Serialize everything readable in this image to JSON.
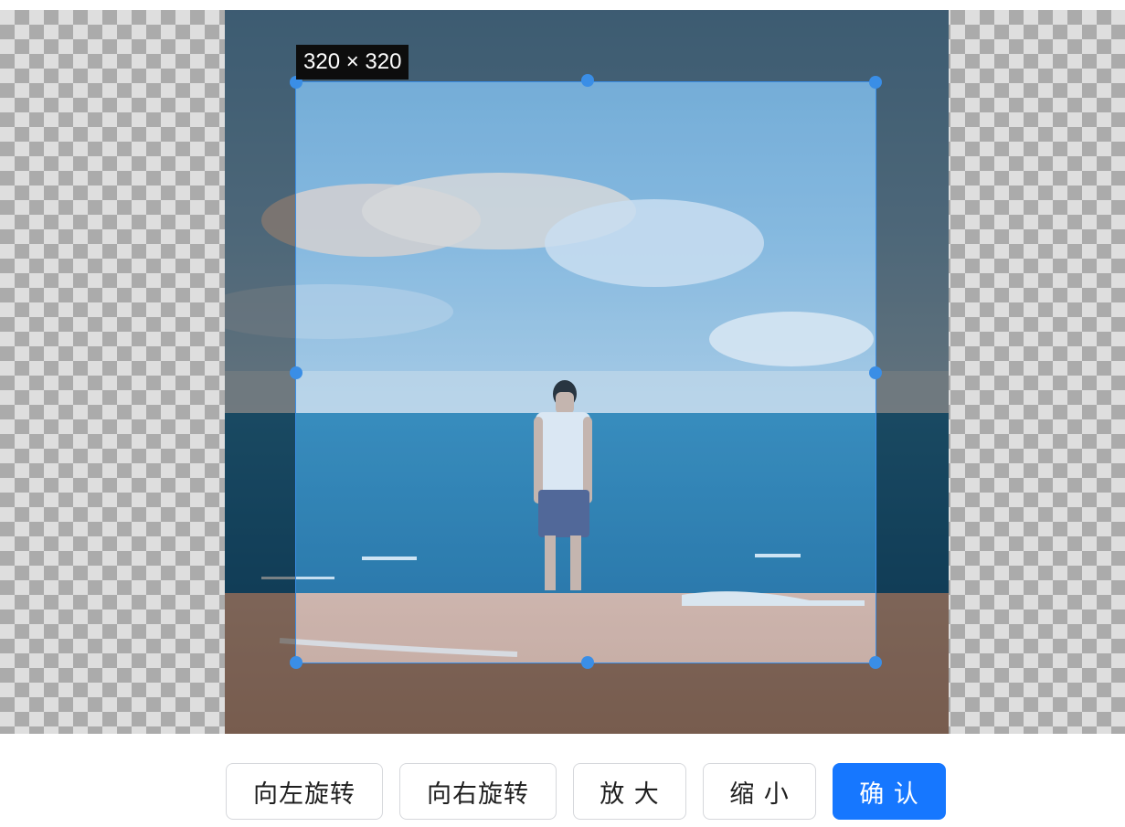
{
  "cropper": {
    "size_label": "320 × 320"
  },
  "toolbar": {
    "rotate_left_label": "向左旋转",
    "rotate_right_label": "向右旋转",
    "zoom_in_label": "放 大",
    "zoom_out_label": "缩 小",
    "confirm_label": "确 认"
  },
  "colors": {
    "accent": "#1677ff",
    "crop_outline": "#3a8ee6"
  },
  "icons": [
    "crop-handle"
  ]
}
